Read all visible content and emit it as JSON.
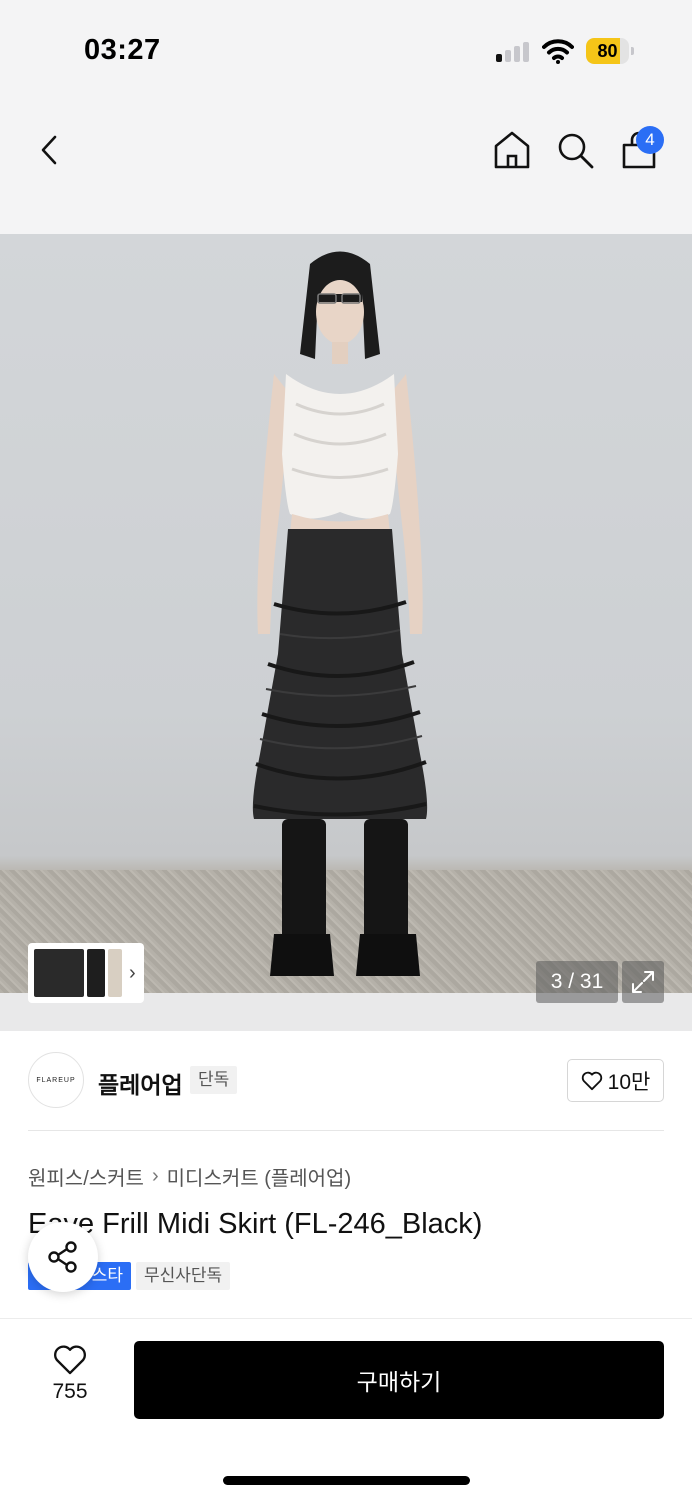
{
  "status_bar": {
    "time": "03:27",
    "battery_level": "80",
    "battery_fraction": 0.8,
    "signal_bars": 1
  },
  "nav": {
    "cart_count": "4",
    "icons": [
      "back-icon",
      "home-icon",
      "search-icon",
      "cart-icon"
    ]
  },
  "gallery": {
    "counter": "3 / 31"
  },
  "brand": {
    "logo_text": "FLAREUP",
    "name": "플레어업",
    "tag": "단독",
    "likes": "10만"
  },
  "product": {
    "breadcrumb": [
      "원피스/스커트",
      "미디스커트 (플레어업)"
    ],
    "title": "Eave Frill Midi Skirt (FL-246_Black)",
    "tags": [
      "스타",
      "무신사단독"
    ]
  },
  "bottom_bar": {
    "wish_count": "755",
    "buy_label": "구매하기"
  },
  "colors": {
    "accent": "#2b6ef5",
    "buy_button": "#000000",
    "battery": "#f5c518"
  }
}
